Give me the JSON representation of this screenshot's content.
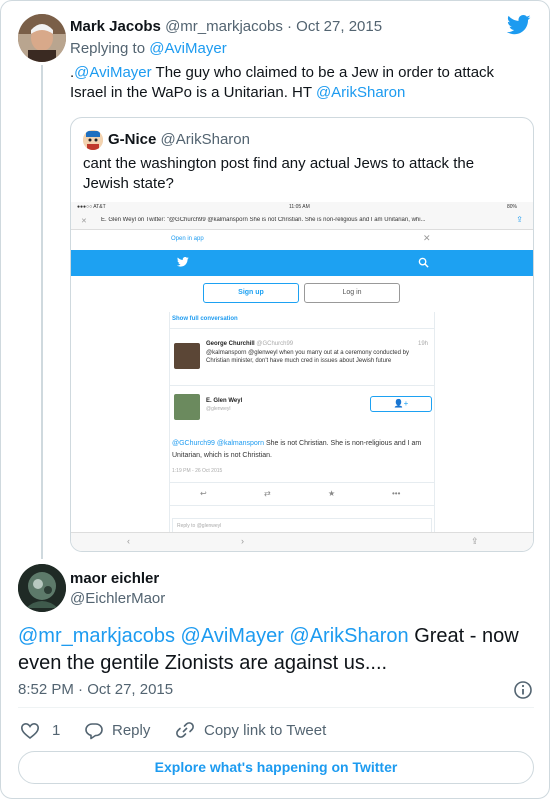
{
  "parent": {
    "name": "Mark Jacobs",
    "handle": "@mr_markjacobs",
    "separator": " · ",
    "date": "Oct 27, 2015",
    "replying_prefix": "Replying to ",
    "replying_handle": "@AviMayer",
    "text_prefix": ".",
    "text_mention": "@AviMayer",
    "text_body": " The guy who claimed to be a Jew in order to attack Israel in the WaPo is a Unitarian. HT ",
    "text_tail_mention": "@ArikSharon"
  },
  "quote": {
    "name": "G-Nice",
    "handle": "@ArikSharon",
    "text": "cant the washington post find any actual Jews to attack the Jewish state?",
    "screenshot": {
      "carrier": "●●●○○ AT&T",
      "time": "11:05 AM",
      "battery": "80%",
      "url": "E. Glen Weyl on Twitter: \"@GChurch99 @kalmansporn She is not Christian. She is non-religious and I am Unitarian, whi...",
      "open_in_app": "Open in app",
      "signup": "Sign up",
      "login": "Log in",
      "show_full": "Show full conversation",
      "gc_name": "George Churchill",
      "gc_handle": "@GChurch99",
      "gc_time": "19h",
      "gc_text": "@kalmansporn @glenweyl when you marry out at a ceremony conducted by Christian minister, don't have much cred in issues about Jewish future",
      "gw_name": "E. Glen Weyl",
      "gw_handle": "@glenweyl",
      "gw_text_mentions": "@GChurch99 @kalmansporn",
      "gw_text_body": " She is not Christian.  She is non-religious and I am Unitarian, which is not Christian.",
      "gw_date": "1:19 PM - 26 Oct 2015",
      "reply_placeholder": "Reply to @glenweyl"
    }
  },
  "main": {
    "name": "maor eichler",
    "handle": "@EichlerMaor",
    "mentions": "@mr_markjacobs @AviMayer @ArikSharon",
    "text": " Great - now even the gentile Zionists are against us....",
    "time": "8:52 PM",
    "separator": " · ",
    "date": "Oct 27, 2015",
    "like_count": "1",
    "reply_label": "Reply",
    "copy_label": "Copy link to Tweet",
    "explore_label": "Explore what's happening on Twitter"
  },
  "colors": {
    "link": "#1d9bf0",
    "muted": "#536471",
    "text": "#0f1419",
    "border": "#cfd9de"
  }
}
